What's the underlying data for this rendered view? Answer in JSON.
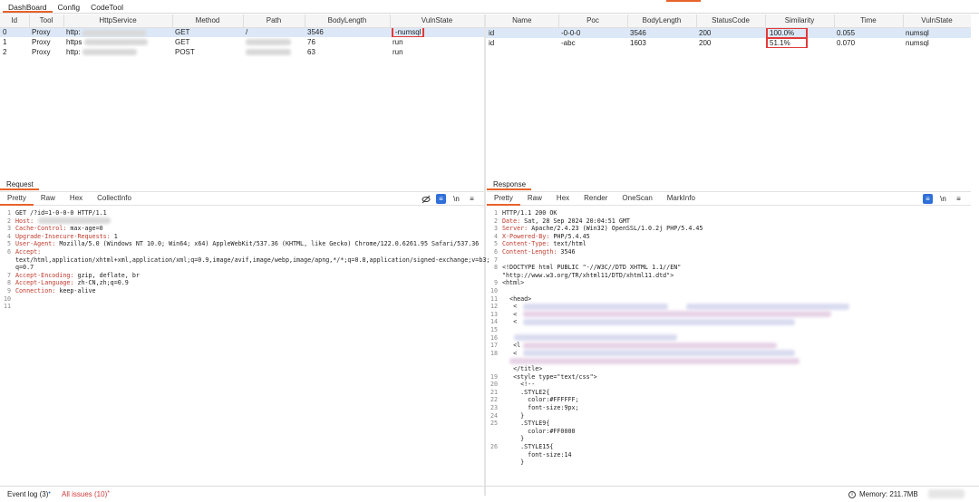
{
  "top_tabs": [
    "DashBoard",
    "Config",
    "CodeTool"
  ],
  "left_table": {
    "columns": [
      "Id",
      "Tool",
      "HttpService",
      "Method",
      "Path",
      "BodyLength",
      "VulnState"
    ],
    "rows": [
      {
        "id": "0",
        "tool": "Proxy",
        "service": "http:",
        "method": "GET",
        "path": "/",
        "body": "3546",
        "vuln": "-numsql"
      },
      {
        "id": "1",
        "tool": "Proxy",
        "service": "https",
        "method": "GET",
        "path": "",
        "body": "76",
        "vuln": "run"
      },
      {
        "id": "2",
        "tool": "Proxy",
        "service": "http:",
        "method": "POST",
        "path": "",
        "body": "63",
        "vuln": "run"
      }
    ]
  },
  "right_table": {
    "columns": [
      "Name",
      "Poc",
      "BodyLength",
      "StatusCode",
      "Similarity",
      "Time",
      "VulnState"
    ],
    "rows": [
      {
        "name": "id",
        "poc": "-0-0-0",
        "body": "3546",
        "status": "200",
        "sim": "100.0%",
        "time": "0.055",
        "vuln": "numsql"
      },
      {
        "name": "id",
        "poc": "-abc",
        "body": "1603",
        "status": "200",
        "sim": "51.1%",
        "time": "0.070",
        "vuln": "numsql"
      }
    ]
  },
  "request": {
    "title": "Request",
    "tabs": [
      "Pretty",
      "Raw",
      "Hex",
      "CollectInfo"
    ],
    "wrap_label": "\\n",
    "menu_glyph": "≡",
    "lines": [
      {
        "n": "1",
        "t": "GET /?id=1-0-0-0 HTTP/1.1"
      },
      {
        "n": "2",
        "t": "Host:"
      },
      {
        "n": "3",
        "t": "Cache-Control: max-age=0"
      },
      {
        "n": "4",
        "t": "Upgrade-Insecure-Requests: 1"
      },
      {
        "n": "5",
        "t": "User-Agent: Mozilla/5.0 (Windows NT 10.0; Win64; x64) AppleWebKit/537.36 (KHTML, like Gecko) Chrome/122.0.6261.95 Safari/537.36"
      },
      {
        "n": "6",
        "t": "Accept:"
      },
      {
        "n": "",
        "t": "text/html,application/xhtml+xml,application/xml;q=0.9,image/avif,image/webp,image/apng,*/*;q=0.8,application/signed-exchange;v=b3;"
      },
      {
        "n": "",
        "t": "q=0.7"
      },
      {
        "n": "7",
        "t": "Accept-Encoding: gzip, deflate, br"
      },
      {
        "n": "8",
        "t": "Accept-Language: zh-CN,zh;q=0.9"
      },
      {
        "n": "9",
        "t": "Connection: keep-alive"
      },
      {
        "n": "10",
        "t": ""
      },
      {
        "n": "11",
        "t": ""
      }
    ]
  },
  "response": {
    "title": "Response",
    "tabs": [
      "Pretty",
      "Raw",
      "Hex",
      "Render",
      "OneScan",
      "MarkInfo"
    ],
    "wrap_label": "\\n",
    "menu_glyph": "≡",
    "lines": [
      {
        "n": "1",
        "t": "HTTP/1.1 200 OK"
      },
      {
        "n": "2",
        "t": "Date: Sat, 28 Sep 2024 20:04:51 GMT"
      },
      {
        "n": "3",
        "t": "Server: Apache/2.4.23 (Win32) OpenSSL/1.0.2j PHP/5.4.45"
      },
      {
        "n": "4",
        "t": "X-Powered-By: PHP/5.4.45"
      },
      {
        "n": "5",
        "t": "Content-Type: text/html"
      },
      {
        "n": "6",
        "t": "Content-Length: 3546"
      },
      {
        "n": "7",
        "t": ""
      },
      {
        "n": "8",
        "t": "<!DOCTYPE html PUBLIC \"-//W3C//DTD XHTML 1.1//EN\""
      },
      {
        "n": "",
        "t": "\"http://www.w3.org/TR/xhtml11/DTD/xhtml11.dtd\">"
      },
      {
        "n": "9",
        "t": "<html>"
      },
      {
        "n": "10",
        "t": ""
      },
      {
        "n": "11",
        "t": "  <head>"
      },
      {
        "n": "12",
        "t": "   <"
      },
      {
        "n": "13",
        "t": "   <"
      },
      {
        "n": "14",
        "t": "   <"
      },
      {
        "n": "15",
        "t": ""
      },
      {
        "n": "16",
        "t": ""
      },
      {
        "n": "17",
        "t": "   <l"
      },
      {
        "n": "18",
        "t": "   <"
      },
      {
        "n": "",
        "t": ""
      },
      {
        "n": "",
        "t": "   </title>"
      },
      {
        "n": "19",
        "t": "   <style type=\"text/css\">"
      },
      {
        "n": "20",
        "t": "     <!--"
      },
      {
        "n": "21",
        "t": "     .STYLE2{"
      },
      {
        "n": "22",
        "t": "       color:#FFFFFF;"
      },
      {
        "n": "23",
        "t": "       font-size:9px;"
      },
      {
        "n": "24",
        "t": "     }"
      },
      {
        "n": "25",
        "t": "     .STYLE9{"
      },
      {
        "n": "",
        "t": "       color:#FF0000"
      },
      {
        "n": "",
        "t": "     }"
      },
      {
        "n": "26",
        "t": "     .STYLE15{"
      },
      {
        "n": "",
        "t": "       font-size:14"
      },
      {
        "n": "",
        "t": "     }"
      }
    ]
  },
  "status": {
    "event_log": "Event log (3)",
    "event_mark": "•",
    "issues": "All issues (10)",
    "issues_mark": "*",
    "memory": "Memory: 211.7MB"
  }
}
